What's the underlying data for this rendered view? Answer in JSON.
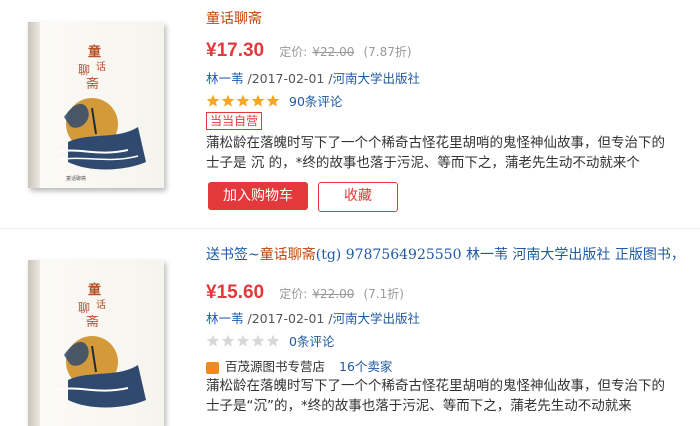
{
  "products": [
    {
      "title": "童话聊斋",
      "price": "¥17.30",
      "list_label": "定价:",
      "list_price": "¥22.00",
      "discount": "(7.87折)",
      "author": "林一苇",
      "date": " /2017-02-01 /",
      "publisher": "河南大学出版社",
      "stars": 5,
      "reviews": "90条评论",
      "badge": "当当自营",
      "description": "蒲松龄在落魄时写下了一个个稀奇古怪花里胡哨的鬼怪神仙故事，但专治下的士子是 沉 的，*终的故事也落于污泥、等而下之，蒲老先生动不动就来个",
      "add_to_cart": "加入购物车",
      "favorite": "收藏",
      "cover_title": "童话聊斋"
    },
    {
      "title_prefix": "送书签~",
      "title_highlight": "童话聊斋",
      "title_suffix": "(tg) 9787564925550 林一苇 河南大学出版社 正版图书，",
      "price": "¥15.60",
      "list_label": "定价:",
      "list_price": "¥22.00",
      "discount": "(7.1折)",
      "author": "林一苇",
      "date": " /2017-02-01 /",
      "publisher": "河南大学出版社",
      "stars": 0,
      "reviews": "0条评论",
      "shop": "百茂源图书专营店",
      "sellers": "16个卖家",
      "description": "蒲松龄在落魄时写下了一个个稀奇古怪花里胡哨的鬼怪神仙故事，但专治下的士子是“沉”的，*终的故事也落于污泥、等而下之，蒲老先生动不动就来",
      "cover_title": "童话聊斋"
    }
  ],
  "colors": {
    "price_red": "#e4393c",
    "link_blue": "#1f5aa6",
    "star_gold": "#f5a623",
    "star_grey": "#d8d8d8",
    "title_orange": "#c1440e"
  }
}
